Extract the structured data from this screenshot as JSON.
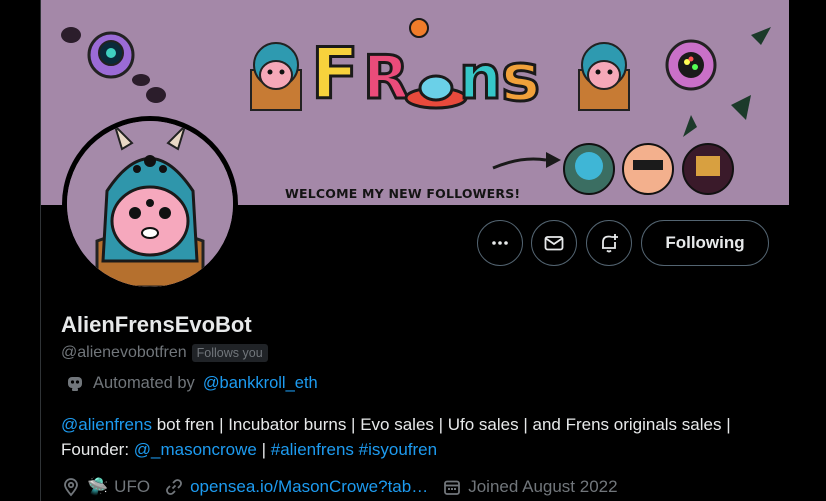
{
  "banner": {
    "title": "FRENS",
    "welcome_text": "WELCOME MY NEW FOLLOWERS!"
  },
  "actions": {
    "more_icon": "more-horizontal-icon",
    "message_icon": "envelope-icon",
    "notify_icon": "bell-plus-icon",
    "follow_label": "Following"
  },
  "profile": {
    "name": "AlienFrensEvoBot",
    "handle": "@alienevobotfren",
    "follows_you": "Follows you",
    "automated_prefix": "Automated by",
    "automated_by": "@bankkroll_eth",
    "bio": {
      "mention1": "@alienfrens",
      "text1": " bot fren | Incubator burns | Evo sales | Ufo sales | and Frens originals sales | Founder: ",
      "mention2": "@_masoncrowe",
      "text2": " | ",
      "hashtag1": "#alienfrens",
      "space": " ",
      "hashtag2": "#isyoufren"
    },
    "location_emoji": "🛸",
    "location": "UFO",
    "website": "opensea.io/MasonCrowe?tab…",
    "joined": "Joined August 2022"
  },
  "colors": {
    "banner_bg": "#a488a8",
    "link": "#1d9bf0",
    "muted": "#71767b",
    "text": "#e7e9ea"
  }
}
